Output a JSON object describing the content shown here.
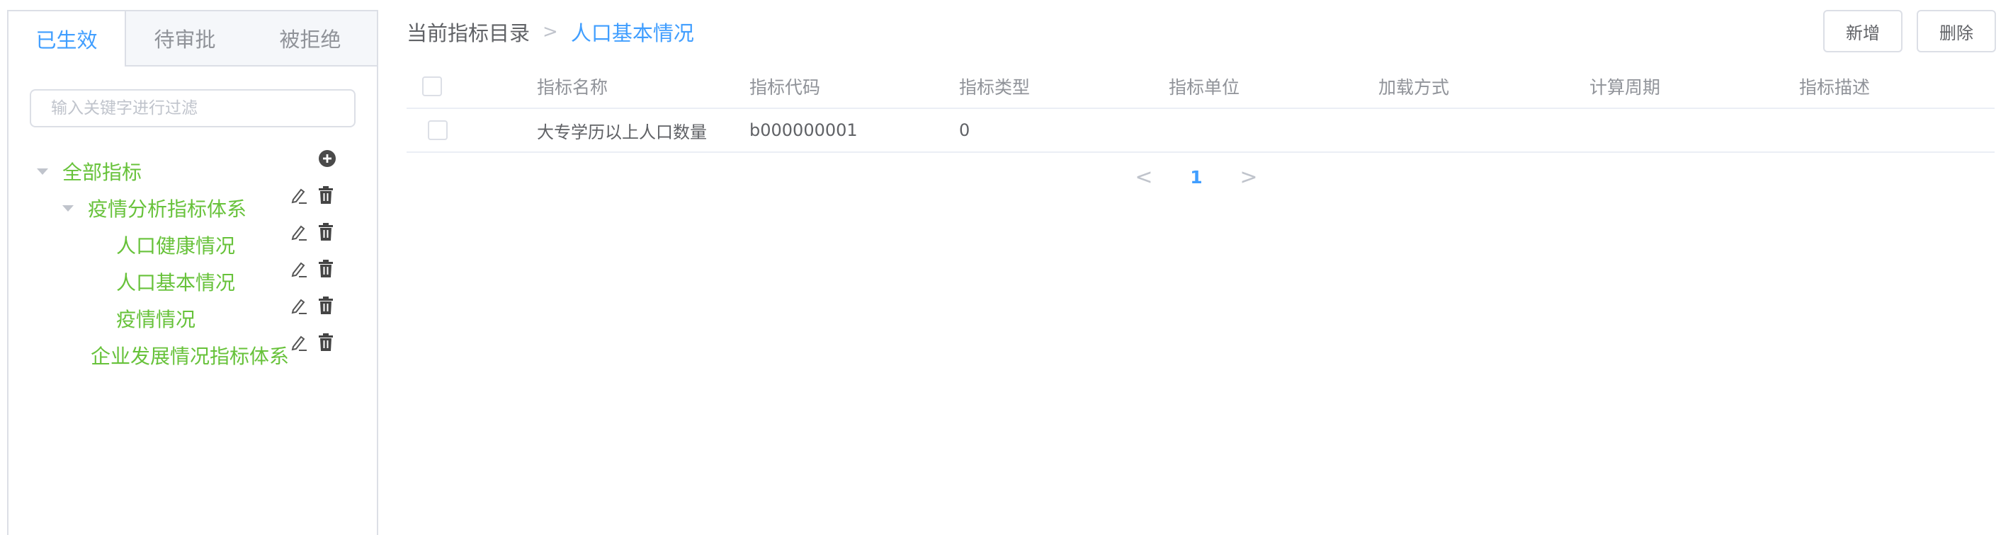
{
  "tabs": [
    "已生效",
    "待审批",
    "被拒绝"
  ],
  "filter": {
    "placeholder": "输入关键字进行过滤"
  },
  "tree": {
    "root": {
      "label": "全部指标"
    },
    "nodes": [
      {
        "label": "疫情分析指标体系"
      },
      {
        "label": "人口健康情况"
      },
      {
        "label": "人口基本情况"
      },
      {
        "label": "疫情情况"
      },
      {
        "label": "企业发展情况指标体系"
      }
    ]
  },
  "breadcrumb": {
    "root": "当前指标目录",
    "separator": ">",
    "current": "人口基本情况"
  },
  "toolbar": {
    "add_label": "新增",
    "delete_label": "删除"
  },
  "table": {
    "columns": [
      "指标名称",
      "指标代码",
      "指标类型",
      "指标单位",
      "加载方式",
      "计算周期",
      "指标描述"
    ],
    "rows": [
      {
        "name": "大专学历以上人口数量",
        "code": "b000000001",
        "type": "0",
        "unit": "",
        "load": "",
        "period": "",
        "desc": ""
      }
    ]
  },
  "pagination": {
    "current_page": "1",
    "prev": "<",
    "next": ">"
  },
  "colors": {
    "accent": "#409eff",
    "tree_text": "#67c23a",
    "border": "#dcdfe6",
    "muted": "#909399"
  }
}
